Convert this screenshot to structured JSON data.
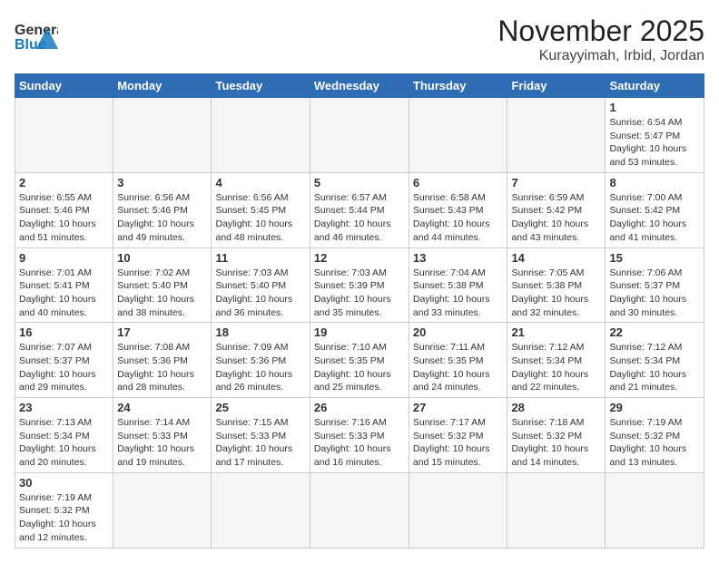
{
  "logo": {
    "general": "General",
    "blue": "Blue"
  },
  "title": "November 2025",
  "subtitle": "Kurayyimah, Irbid, Jordan",
  "weekdays": [
    "Sunday",
    "Monday",
    "Tuesday",
    "Wednesday",
    "Thursday",
    "Friday",
    "Saturday"
  ],
  "weeks": [
    [
      {
        "day": "",
        "info": ""
      },
      {
        "day": "",
        "info": ""
      },
      {
        "day": "",
        "info": ""
      },
      {
        "day": "",
        "info": ""
      },
      {
        "day": "",
        "info": ""
      },
      {
        "day": "",
        "info": ""
      },
      {
        "day": "1",
        "info": "Sunrise: 6:54 AM\nSunset: 5:47 PM\nDaylight: 10 hours and 53 minutes."
      }
    ],
    [
      {
        "day": "2",
        "info": "Sunrise: 6:55 AM\nSunset: 5:46 PM\nDaylight: 10 hours and 51 minutes."
      },
      {
        "day": "3",
        "info": "Sunrise: 6:56 AM\nSunset: 5:46 PM\nDaylight: 10 hours and 49 minutes."
      },
      {
        "day": "4",
        "info": "Sunrise: 6:56 AM\nSunset: 5:45 PM\nDaylight: 10 hours and 48 minutes."
      },
      {
        "day": "5",
        "info": "Sunrise: 6:57 AM\nSunset: 5:44 PM\nDaylight: 10 hours and 46 minutes."
      },
      {
        "day": "6",
        "info": "Sunrise: 6:58 AM\nSunset: 5:43 PM\nDaylight: 10 hours and 44 minutes."
      },
      {
        "day": "7",
        "info": "Sunrise: 6:59 AM\nSunset: 5:42 PM\nDaylight: 10 hours and 43 minutes."
      },
      {
        "day": "8",
        "info": "Sunrise: 7:00 AM\nSunset: 5:42 PM\nDaylight: 10 hours and 41 minutes."
      }
    ],
    [
      {
        "day": "9",
        "info": "Sunrise: 7:01 AM\nSunset: 5:41 PM\nDaylight: 10 hours and 40 minutes."
      },
      {
        "day": "10",
        "info": "Sunrise: 7:02 AM\nSunset: 5:40 PM\nDaylight: 10 hours and 38 minutes."
      },
      {
        "day": "11",
        "info": "Sunrise: 7:03 AM\nSunset: 5:40 PM\nDaylight: 10 hours and 36 minutes."
      },
      {
        "day": "12",
        "info": "Sunrise: 7:03 AM\nSunset: 5:39 PM\nDaylight: 10 hours and 35 minutes."
      },
      {
        "day": "13",
        "info": "Sunrise: 7:04 AM\nSunset: 5:38 PM\nDaylight: 10 hours and 33 minutes."
      },
      {
        "day": "14",
        "info": "Sunrise: 7:05 AM\nSunset: 5:38 PM\nDaylight: 10 hours and 32 minutes."
      },
      {
        "day": "15",
        "info": "Sunrise: 7:06 AM\nSunset: 5:37 PM\nDaylight: 10 hours and 30 minutes."
      }
    ],
    [
      {
        "day": "16",
        "info": "Sunrise: 7:07 AM\nSunset: 5:37 PM\nDaylight: 10 hours and 29 minutes."
      },
      {
        "day": "17",
        "info": "Sunrise: 7:08 AM\nSunset: 5:36 PM\nDaylight: 10 hours and 28 minutes."
      },
      {
        "day": "18",
        "info": "Sunrise: 7:09 AM\nSunset: 5:36 PM\nDaylight: 10 hours and 26 minutes."
      },
      {
        "day": "19",
        "info": "Sunrise: 7:10 AM\nSunset: 5:35 PM\nDaylight: 10 hours and 25 minutes."
      },
      {
        "day": "20",
        "info": "Sunrise: 7:11 AM\nSunset: 5:35 PM\nDaylight: 10 hours and 24 minutes."
      },
      {
        "day": "21",
        "info": "Sunrise: 7:12 AM\nSunset: 5:34 PM\nDaylight: 10 hours and 22 minutes."
      },
      {
        "day": "22",
        "info": "Sunrise: 7:12 AM\nSunset: 5:34 PM\nDaylight: 10 hours and 21 minutes."
      }
    ],
    [
      {
        "day": "23",
        "info": "Sunrise: 7:13 AM\nSunset: 5:34 PM\nDaylight: 10 hours and 20 minutes."
      },
      {
        "day": "24",
        "info": "Sunrise: 7:14 AM\nSunset: 5:33 PM\nDaylight: 10 hours and 19 minutes."
      },
      {
        "day": "25",
        "info": "Sunrise: 7:15 AM\nSunset: 5:33 PM\nDaylight: 10 hours and 17 minutes."
      },
      {
        "day": "26",
        "info": "Sunrise: 7:16 AM\nSunset: 5:33 PM\nDaylight: 10 hours and 16 minutes."
      },
      {
        "day": "27",
        "info": "Sunrise: 7:17 AM\nSunset: 5:32 PM\nDaylight: 10 hours and 15 minutes."
      },
      {
        "day": "28",
        "info": "Sunrise: 7:18 AM\nSunset: 5:32 PM\nDaylight: 10 hours and 14 minutes."
      },
      {
        "day": "29",
        "info": "Sunrise: 7:19 AM\nSunset: 5:32 PM\nDaylight: 10 hours and 13 minutes."
      }
    ],
    [
      {
        "day": "30",
        "info": "Sunrise: 7:19 AM\nSunset: 5:32 PM\nDaylight: 10 hours and 12 minutes."
      },
      {
        "day": "",
        "info": ""
      },
      {
        "day": "",
        "info": ""
      },
      {
        "day": "",
        "info": ""
      },
      {
        "day": "",
        "info": ""
      },
      {
        "day": "",
        "info": ""
      },
      {
        "day": "",
        "info": ""
      }
    ]
  ]
}
